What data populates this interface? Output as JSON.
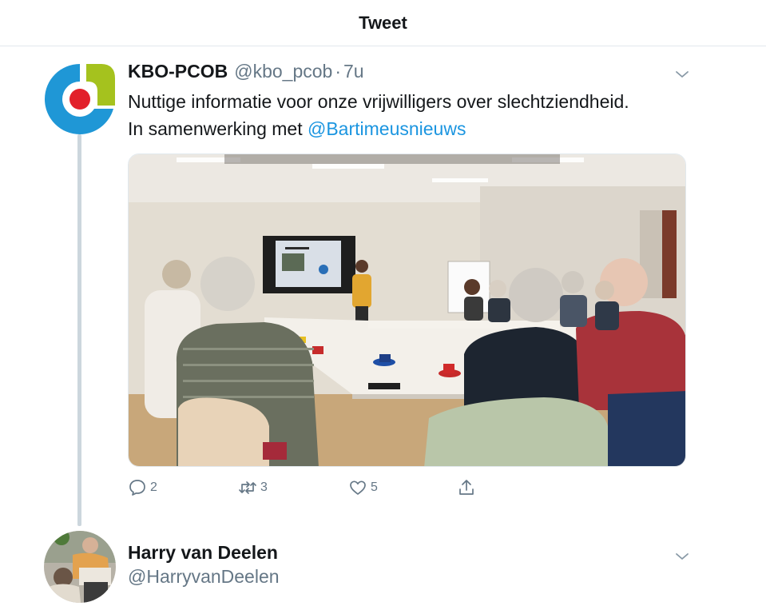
{
  "header": {
    "title": "Tweet"
  },
  "tweet": {
    "author": {
      "name": "KBO-PCOB",
      "handle": "@kbo_pcob",
      "dot": "·",
      "time": "7u"
    },
    "text_line1": "Nuttige informatie voor onze vrijwilligers over slechtziendheid.",
    "text_line2_prefix": "In samenwerking met ",
    "mention": "@Bartimeusnieuws",
    "media": {
      "description_icon": "photo-meeting-room"
    },
    "actions": {
      "reply_count": "2",
      "retweet_count": "3",
      "like_count": "5"
    }
  },
  "reply": {
    "name": "Harry van Deelen",
    "handle": "@HarryvanDeelen"
  },
  "colors": {
    "link": "#1b95e0",
    "secondary_text": "#657786",
    "border": "#e1e8ed",
    "thread_line": "#ccd6dd",
    "logo_blue": "#1f97d6",
    "logo_green": "#a5c21e",
    "logo_red": "#e2202a"
  }
}
